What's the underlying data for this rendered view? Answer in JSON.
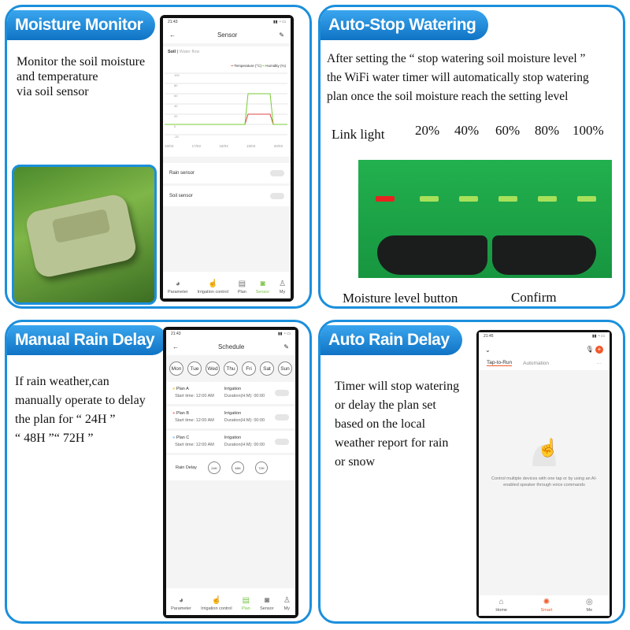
{
  "panels": {
    "moisture": {
      "title": "Moisture Monitor",
      "text": "Monitor the soil moisture\nand temperature\nvia soil sensor",
      "phone": {
        "time": "21:43",
        "title": "Sensor",
        "tabs": [
          "Soil",
          "Water flow"
        ],
        "legend": [
          "Temperature (°C)",
          "Humidity (%)"
        ],
        "yticks": [
          "100",
          "80",
          "60",
          "40",
          "20",
          "0",
          "-20"
        ],
        "xticks": [
          "16/03",
          "17/03",
          "18/03",
          "19/03",
          "20/03"
        ],
        "rows": [
          "Rain sensor",
          "Soil sensor"
        ],
        "nav": [
          "Parameter",
          "Irrigation control",
          "Plan",
          "Sensor",
          "My"
        ]
      }
    },
    "autostop": {
      "title": "Auto-Stop Watering",
      "text": "After setting the “ stop watering soil moisture level ”\nthe WiFi water timer will automatically stop watering\nplan once the soil moisture reach the setting level",
      "link_light": "Link light",
      "levels": [
        "20%",
        "40%",
        "60%",
        "80%",
        "100%"
      ],
      "moisture_button": "Moisture level button",
      "confirm": "Confirm",
      "colors": {
        "link": "#e8231f",
        "level": "#a8e05a",
        "body": "#1fa84a"
      }
    },
    "rain": {
      "title": "Manual Rain Delay",
      "text": "If rain weather,can\n manually operate to delay\nthe plan for “ 24H ”\n“ 48H ”“ 72H ”",
      "phone": {
        "time": "21:43",
        "title": "Schedule",
        "days": [
          "Mon",
          "Tue",
          "Wed",
          "Thu",
          "Fri",
          "Sat",
          "Sun"
        ],
        "plans": [
          {
            "name": "Plan A",
            "start": "Start time: 12:00 AM",
            "type": "Irrigation",
            "duration": "Duration(H:M): 00:00",
            "color": "#f5d04a"
          },
          {
            "name": "Plan B",
            "start": "Start time: 12:00 AM",
            "type": "Irrigation",
            "duration": "Duration(H:M): 00:00",
            "color": "#ee8a8a"
          },
          {
            "name": "Plan C",
            "start": "Start time: 12:00 AM",
            "type": "Irrigation",
            "duration": "Duration(H:M): 00:00",
            "color": "#8cc4f0"
          }
        ],
        "rain_delay": "Rain Delay",
        "delays": [
          "24H",
          "48H",
          "72H"
        ],
        "nav": [
          "Parameter",
          "Irrigation control",
          "Plan",
          "Sensor",
          "My"
        ]
      }
    },
    "auto": {
      "title": "Auto Rain Delay",
      "text": "Timer will stop watering\nor delay the plan set\nbased on the local\nweather report for rain\nor snow",
      "phone": {
        "time": "21:45",
        "tabs": [
          "Tap-to-Run",
          "Automation"
        ],
        "empty": "Control multiple devices with one tap or by using an AI-enabled speaker through voice commands",
        "nav": [
          "Home",
          "Smart",
          "Me"
        ],
        "accent": "#f2582a"
      }
    }
  }
}
